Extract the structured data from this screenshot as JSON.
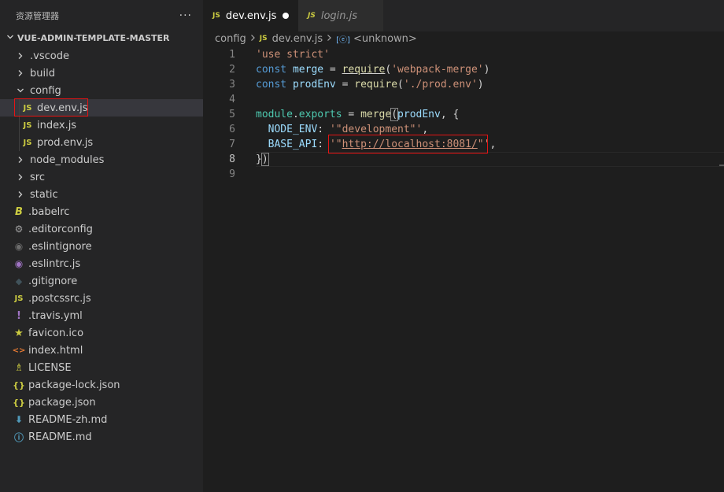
{
  "sidebar": {
    "title": "资源管理器",
    "more": "···",
    "section": "VUE-ADMIN-TEMPLATE-MASTER",
    "folders_top": [
      {
        "label": ".vscode"
      },
      {
        "label": "build"
      },
      {
        "label": "config"
      }
    ],
    "config_files": [
      {
        "label": "dev.env.js",
        "icon": "JS"
      },
      {
        "label": "index.js",
        "icon": "JS"
      },
      {
        "label": "prod.env.js",
        "icon": "JS"
      }
    ],
    "folders_bottom": [
      {
        "label": "node_modules"
      },
      {
        "label": "src"
      },
      {
        "label": "static"
      }
    ],
    "files": [
      {
        "label": ".babelrc",
        "icon": "B"
      },
      {
        "label": ".editorconfig",
        "icon": "⚙"
      },
      {
        "label": ".eslintignore",
        "icon": "◉"
      },
      {
        "label": ".eslintrc.js",
        "icon": "◉"
      },
      {
        "label": ".gitignore",
        "icon": "◆"
      },
      {
        "label": ".postcssrc.js",
        "icon": "JS"
      },
      {
        "label": ".travis.yml",
        "icon": "!"
      },
      {
        "label": "favicon.ico",
        "icon": "★"
      },
      {
        "label": "index.html",
        "icon": "<>"
      },
      {
        "label": "LICENSE",
        "icon": "♗"
      },
      {
        "label": "package-lock.json",
        "icon": "{}"
      },
      {
        "label": "package.json",
        "icon": "{}"
      },
      {
        "label": "README-zh.md",
        "icon": "⬇"
      },
      {
        "label": "README.md",
        "icon": "ⓘ"
      }
    ]
  },
  "tabs": [
    {
      "icon": "JS",
      "label": "dev.env.js"
    },
    {
      "icon": "JS",
      "label": "login.js"
    }
  ],
  "breadcrumb": {
    "folder": "config",
    "file_icon": "JS",
    "file": "dev.env.js",
    "symbol_icon": "[ⓔ]",
    "symbol": "<unknown>"
  },
  "code": {
    "line_numbers": [
      "1",
      "2",
      "3",
      "4",
      "5",
      "6",
      "7",
      "8",
      "9"
    ],
    "l1": "'use strict'",
    "l2_kw": "const",
    "l2_var": "merge",
    "l2_eq": " = ",
    "l2_fn": "require",
    "l2_p1": "(",
    "l2_str": "'webpack-merge'",
    "l2_p2": ")",
    "l3_kw": "const",
    "l3_var": "prodEnv",
    "l3_eq": " = ",
    "l3_fn": "require",
    "l3_p1": "(",
    "l3_str": "'./prod.env'",
    "l3_p2": ")",
    "l5_obj": "module",
    "l5_dot": ".",
    "l5_prop": "exports",
    "l5_eq": " = ",
    "l5_fn": "merge",
    "l5_p1": "(",
    "l5_var": "prodEnv",
    "l5_rest": ", {",
    "l6_key": "NODE_ENV",
    "l6_colon": ": ",
    "l6_str": "'\"development\"'",
    "l6_comma": ",",
    "l7_key": "BASE_API",
    "l7_colon": ": ",
    "l7_q1": "'\"",
    "l7_url": "http://localhost:8081/",
    "l7_q2": "\"'",
    "l7_comma": ",",
    "l8_a": "}",
    "l8_b": ")"
  }
}
